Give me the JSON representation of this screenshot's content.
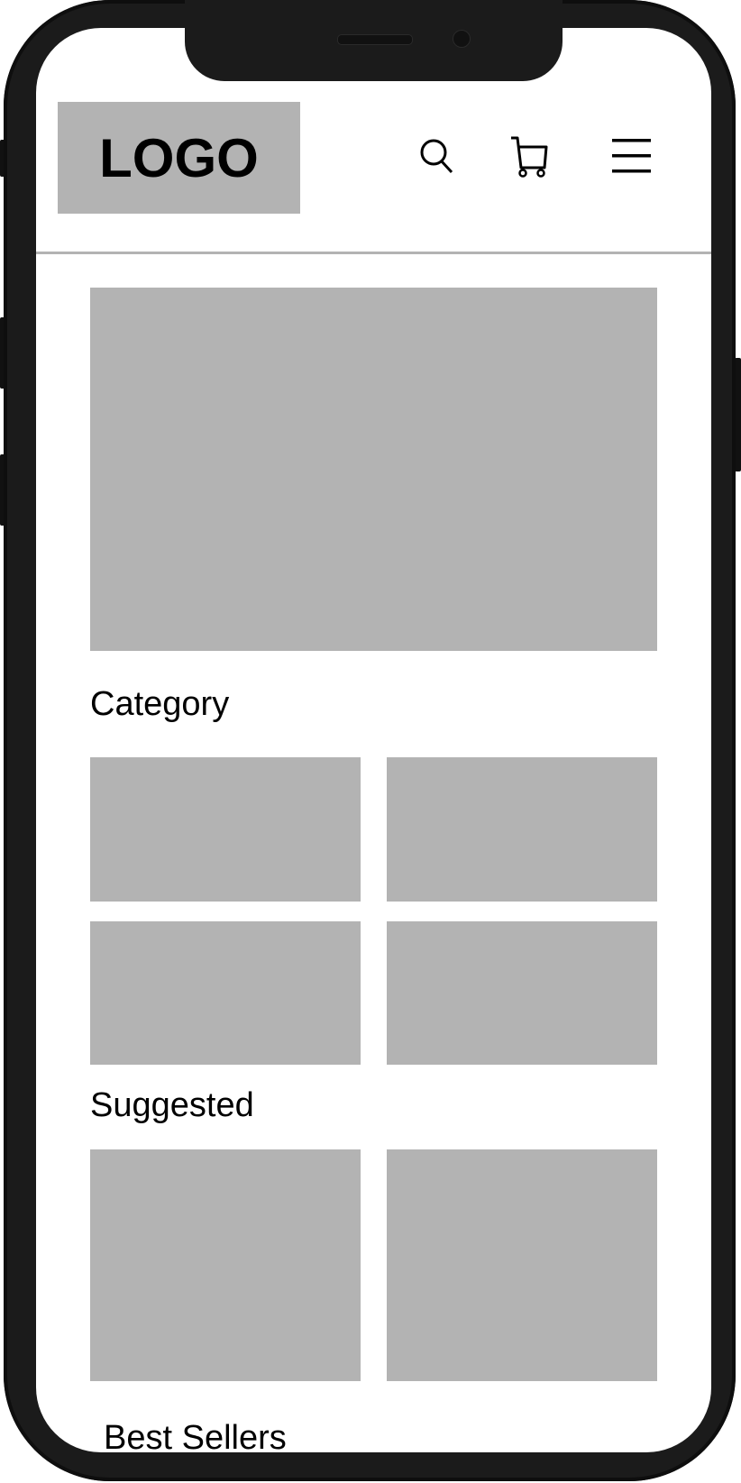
{
  "header": {
    "logo_text": "LOGO",
    "icons": [
      "search-icon",
      "cart-icon",
      "menu-icon"
    ]
  },
  "sections": {
    "category": "Category",
    "suggested": "Suggested",
    "best_sellers": "Best Sellers"
  },
  "colors": {
    "placeholder": "#b3b3b3",
    "frame": "#1b1b1b"
  }
}
